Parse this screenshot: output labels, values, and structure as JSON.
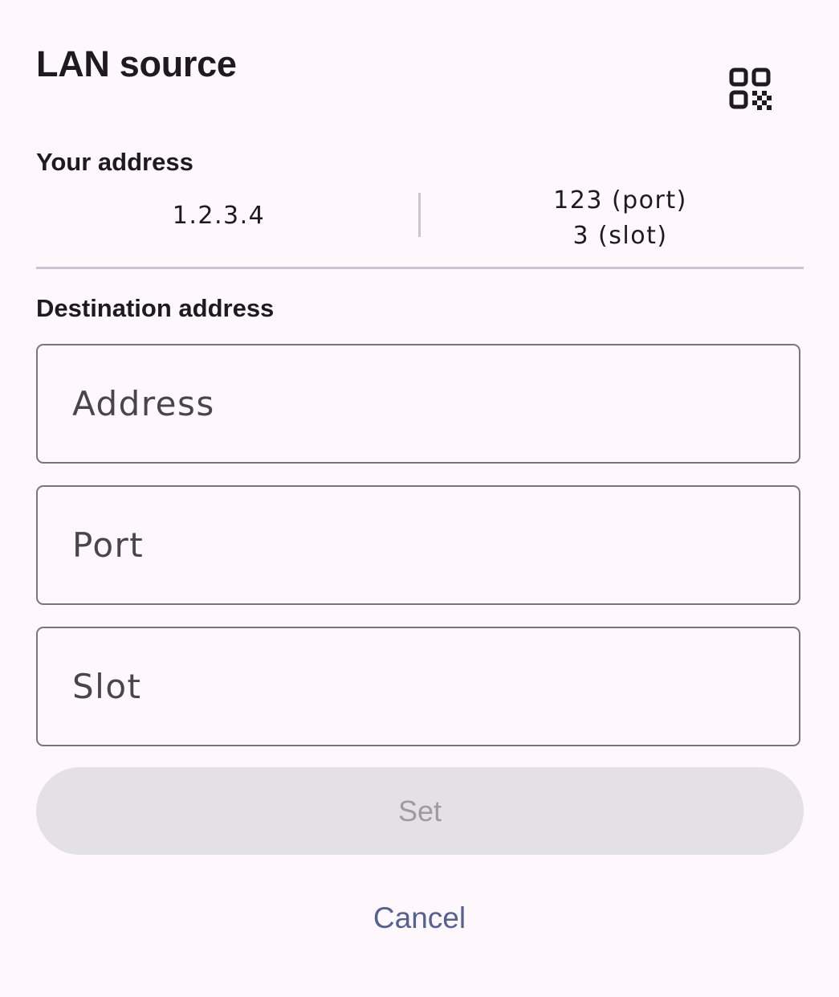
{
  "dialog": {
    "title": "LAN source",
    "qr_icon": "qr-code-scanner-icon"
  },
  "your_address": {
    "label": "Your address",
    "ip": "1.2.3.4",
    "port": "123 (port)",
    "slot": "3 (slot)"
  },
  "destination": {
    "label": "Destination address",
    "address": {
      "value": "",
      "placeholder": "Address"
    },
    "port": {
      "value": "",
      "placeholder": "Port"
    },
    "slot": {
      "value": "",
      "placeholder": "Slot"
    }
  },
  "actions": {
    "set_label": "Set",
    "set_enabled": false,
    "cancel_label": "Cancel"
  },
  "colors": {
    "background": "#fef7fc",
    "text": "#1d1b20",
    "outline": "#79747e",
    "disabled_button_bg": "#e3e1e5",
    "disabled_button_text": "#9d9aa0",
    "accent": "#55618f"
  }
}
